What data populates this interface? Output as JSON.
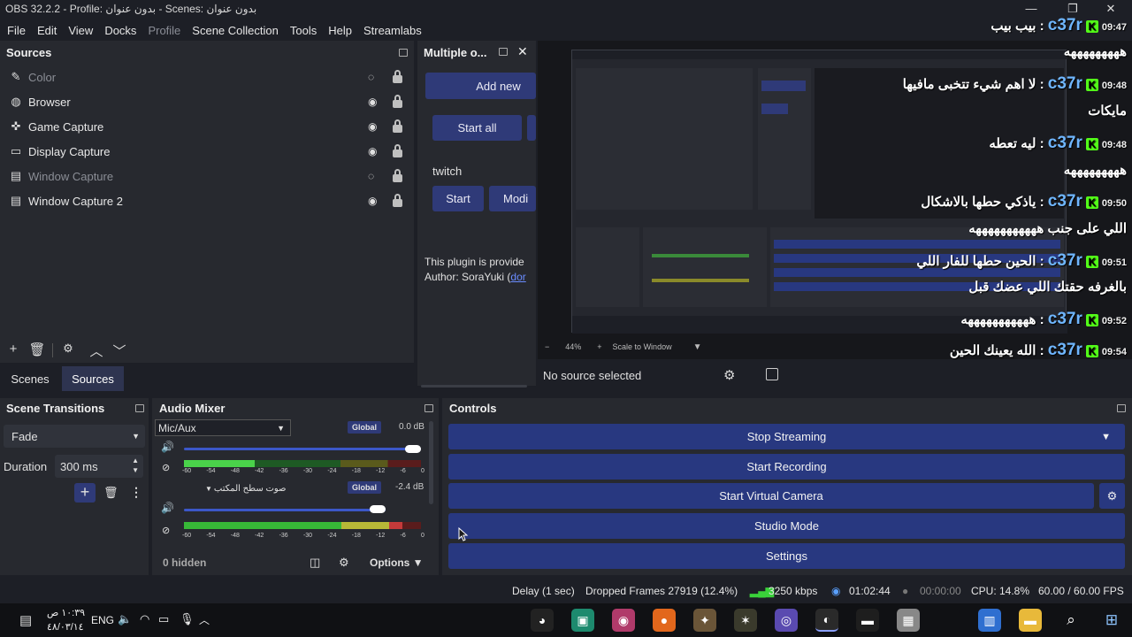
{
  "window": {
    "title": "OBS 32.2.2 - Profile: بدون عنوان - Scenes: بدون عنوان"
  },
  "menu": [
    "File",
    "Edit",
    "View",
    "Docks",
    "Profile",
    "Scene Collection",
    "Tools",
    "Help",
    "Streamlabs"
  ],
  "sources": {
    "title": "Sources",
    "items": [
      {
        "label": "Color",
        "icon": "paint-brush-icon",
        "visible": false
      },
      {
        "label": "Browser",
        "icon": "globe-icon",
        "visible": true
      },
      {
        "label": "Game Capture",
        "icon": "gamepad-icon",
        "visible": true
      },
      {
        "label": "Display Capture",
        "icon": "monitor-icon",
        "visible": true
      },
      {
        "label": "Window Capture",
        "icon": "window-icon",
        "visible": false
      },
      {
        "label": "Window Capture 2",
        "icon": "window-icon",
        "visible": true
      }
    ]
  },
  "multi": {
    "title": "Multiple o...",
    "add_new": "Add new",
    "start_all": "Start all",
    "target_name": "twitch",
    "start": "Start",
    "modify": "Modi",
    "plugin_text": "This plugin is provide",
    "author_prefix": "Author: SoraYuki (",
    "author_link": "dor"
  },
  "tabs": {
    "scenes": "Scenes",
    "sources": "Sources"
  },
  "preview": {
    "zoom": "44%",
    "scale_mode": "Scale to Window",
    "no_source": "No source selected"
  },
  "chat": [
    {
      "time": "09:47",
      "user": "c37r",
      "msg": "بيب بيب",
      "cont": "هههههههههه"
    },
    {
      "time": "09:48",
      "user": "c37r",
      "msg": "لا اهم شيء تتخبى مافيها",
      "cont": "مايكات"
    },
    {
      "time": "09:48",
      "user": "c37r",
      "msg": "ليه تعطه",
      "cont": "هههههههههه"
    },
    {
      "time": "09:50",
      "user": "c37r",
      "msg": "ياذكي حطها بالاشكال",
      "cont": "اللي على جنب هههههههههههه"
    },
    {
      "time": "09:51",
      "user": "c37r",
      "msg": "الحين حطها للفار اللي",
      "cont": "بالغرفه حقتك اللي عضك قبل"
    },
    {
      "time": "09:52",
      "user": "c37r",
      "msg": "هههههههههههه",
      "cont": ""
    },
    {
      "time": "09:54",
      "user": "c37r",
      "msg": "الله يعينك الحين",
      "cont": ""
    }
  ],
  "scene_transitions": {
    "title": "Scene Transitions",
    "transition": "Fade",
    "duration_label": "Duration",
    "duration_value": "300 ms"
  },
  "audio": {
    "title": "Audio Mixer",
    "ticks": [
      "-60",
      "-54",
      "-48",
      "-42",
      "-36",
      "-30",
      "-24",
      "-18",
      "-12",
      "-6",
      "0"
    ],
    "channels": [
      {
        "name": "Mic/Aux",
        "badge": "Global",
        "db": "0.0 dB",
        "volume": 1.0,
        "level": 0.3
      },
      {
        "name": "صوت سطح المكتب",
        "badge": "Global",
        "db": "-2.4 dB",
        "volume": 0.85,
        "level": 0.92
      }
    ],
    "hidden": "0 hidden",
    "options": "Options"
  },
  "controls": {
    "title": "Controls",
    "stop_streaming": "Stop Streaming",
    "start_recording": "Start Recording",
    "start_virtual_camera": "Start Virtual Camera",
    "studio_mode": "Studio Mode",
    "settings": "Settings"
  },
  "status": {
    "delay": "Delay (1 sec)",
    "dropped": "Dropped Frames 27919 (12.4%)",
    "bitrate": "3250 kbps",
    "stream_time": "01:02:44",
    "rec_time": "00:00:00",
    "cpu": "CPU: 14.8%",
    "fps": "60.00 / 60.00 FPS"
  },
  "taskbar": {
    "time": "١٠:٣٩ ص",
    "date": "٤٨/٠٣/١٤",
    "lang": "ENG"
  },
  "colors": {
    "accent": "#283880",
    "bg": "#1d1f26",
    "dock": "#27292f",
    "kick": "#53fc18"
  }
}
